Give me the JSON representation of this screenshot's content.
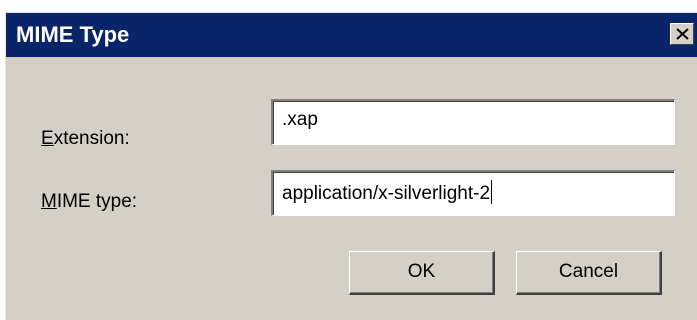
{
  "window": {
    "title": "MIME Type"
  },
  "form": {
    "extension_label": {
      "accesskey": "E",
      "rest": "xtension:"
    },
    "extension_value": ".xap",
    "mime_label": {
      "accesskey": "M",
      "rest": "IME type:"
    },
    "mime_value": "application/x-silverlight-2"
  },
  "buttons": {
    "ok_label": "OK",
    "cancel_label": "Cancel"
  },
  "colors": {
    "titlebar": "#0a246a",
    "dialog_bg": "#d4d0c8",
    "field_bg": "#ffffff"
  },
  "icons": {
    "close": "close-icon"
  }
}
